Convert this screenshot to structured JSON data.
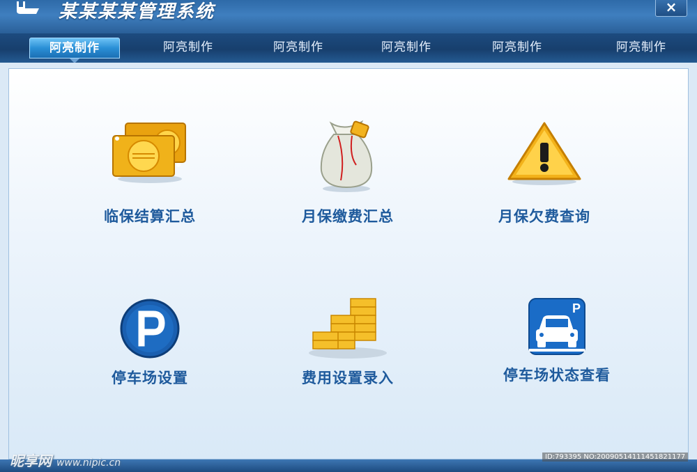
{
  "window": {
    "title": "某某某某管理系统",
    "close_label": "×"
  },
  "tabs": [
    {
      "label": "阿亮制作",
      "active": true
    },
    {
      "label": "阿亮制作",
      "active": false
    },
    {
      "label": "阿亮制作",
      "active": false
    },
    {
      "label": "阿亮制作",
      "active": false
    },
    {
      "label": "阿亮制作",
      "active": false
    },
    {
      "label": "阿亮制作",
      "active": false
    }
  ],
  "tiles": [
    {
      "label": "临保结算汇总",
      "icon": "gold-coins-icon"
    },
    {
      "label": "月保缴费汇总",
      "icon": "money-bag-icon"
    },
    {
      "label": "月保欠费查询",
      "icon": "warning-icon"
    },
    {
      "label": "停车场设置",
      "icon": "parking-sign-icon"
    },
    {
      "label": "费用设置录入",
      "icon": "stacked-coins-icon"
    },
    {
      "label": "停车场状态查看",
      "icon": "parked-car-icon"
    }
  ],
  "footer": {
    "watermark_brand": "昵享网",
    "watermark_url": "www.nipic.cn",
    "image_id": "ID:793395 NO:20090514111451821177"
  },
  "colors": {
    "title_bar": "#2e6aa8",
    "tab_active": "#2a8fd6",
    "label_text": "#1e5a9c",
    "panel_bg": "#eef5fc"
  }
}
